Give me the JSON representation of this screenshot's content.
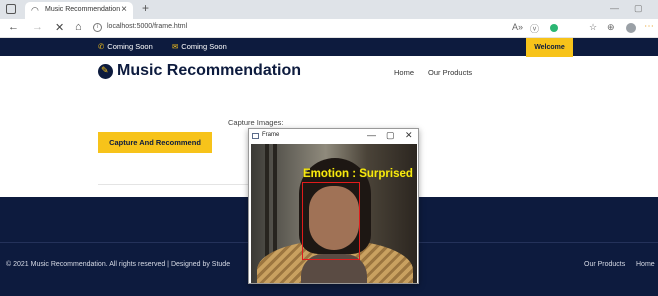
{
  "browser": {
    "tab_title": "Music Recommendation",
    "tab_close": "×",
    "new_tab": "+",
    "window_controls": [
      "—",
      "▢"
    ],
    "url": "localhost:5000/frame.html",
    "nav": {
      "back": "←",
      "forward": "→",
      "reload": "✕",
      "home": "⌂"
    },
    "toolbar_icons": [
      "A»",
      "ⓥ",
      "☆",
      "⊕"
    ]
  },
  "topbar": {
    "phone_icon": "📞",
    "phone_text": "Coming Soon",
    "email_icon": "✉",
    "email_text": "Coming Soon",
    "welcome": "Welcome"
  },
  "header": {
    "brand": "Music Recommendation",
    "nav_home": "Home",
    "nav_products": "Our Products"
  },
  "main": {
    "capture_label": "Capture Images:",
    "capture_button": "Capture And Recommend"
  },
  "footer": {
    "copyright": "© 2021 Music Recommendation. All rights reserved | Designed by Stude",
    "link_products": "Our Products",
    "link_home": "Home"
  },
  "frame_window": {
    "title": "Frame",
    "controls": [
      "—",
      "▢",
      "✕"
    ],
    "emotion_label": "Emotion : Surprised"
  },
  "colors": {
    "navy": "#0d1b3e",
    "accent_yellow": "#f7c31a",
    "detection_box": "#e11b1b",
    "emotion_text": "#f7e80f"
  }
}
